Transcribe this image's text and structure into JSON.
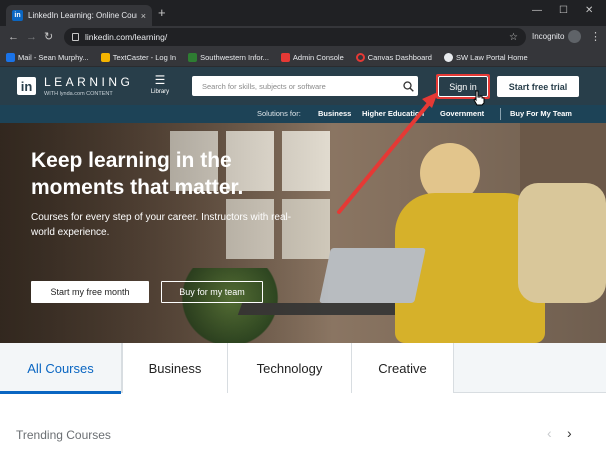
{
  "browser": {
    "tab_title": "LinkedIn Learning: Online Courses",
    "tab_close": "×",
    "new_tab": "+",
    "url": "linkedin.com/learning/",
    "incognito_label": "Incognito",
    "window_min": "—",
    "window_max": "☐",
    "window_close": "✕",
    "bookmarks": [
      {
        "label": "Mail - Sean Murphy...",
        "color": "#1a73e8"
      },
      {
        "label": "TextCaster - Log In",
        "color": "#f4b400"
      },
      {
        "label": "Southwestern Infor...",
        "color": "#2e7d32"
      },
      {
        "label": "Admin Console",
        "color": "#e53935"
      },
      {
        "label": "Canvas Dashboard",
        "color": "#e53935"
      },
      {
        "label": "SW Law Portal Home",
        "color": "#e8eaed"
      }
    ]
  },
  "header": {
    "logo": "in",
    "brand": "LEARNING",
    "brand_sub": "WITH lynda.com CONTENT",
    "library_label": "Library",
    "search_placeholder": "Search for skills, subjects or software",
    "signin_label": "Sign in",
    "trial_label": "Start free trial"
  },
  "subnav": {
    "solutions_label": "Solutions for:",
    "items": [
      "Business",
      "Higher Education",
      "Government",
      "Buy For My Team"
    ]
  },
  "hero": {
    "headline": "Keep learning in the moments that matter.",
    "description": "Courses for every step of your career. Instructors with real-world experience.",
    "primary_button": "Start my free month",
    "secondary_button": "Buy for my team"
  },
  "course_tabs": [
    "All Courses",
    "Business",
    "Technology",
    "Creative"
  ],
  "trending": {
    "title": "Trending Courses",
    "prev": "‹",
    "next": "›"
  },
  "colors": {
    "header_bg": "#283e4a",
    "subnav_bg": "#1d4357",
    "accent": "#0a66c2",
    "annotation": "#e53935"
  }
}
